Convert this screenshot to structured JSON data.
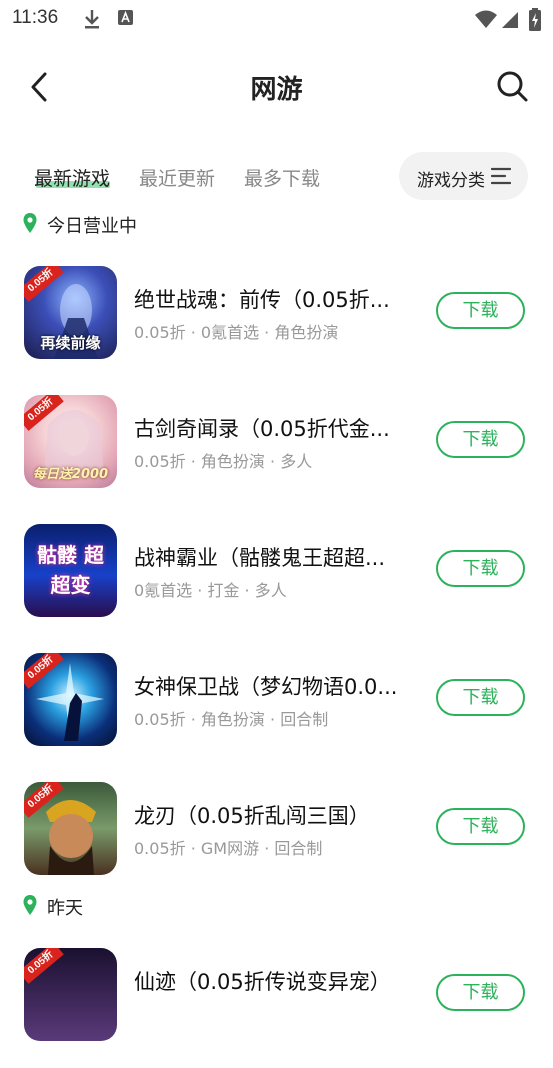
{
  "status_bar": {
    "time": "11:36",
    "icons": [
      "download-icon",
      "a-icon",
      "wifi-icon",
      "signal-icon",
      "battery-icon"
    ]
  },
  "header": {
    "title": "网游",
    "back_icon": "chevron-left-icon",
    "search_icon": "search-icon"
  },
  "tabs": {
    "items": [
      {
        "label": "最新游戏",
        "active": true
      },
      {
        "label": "最近更新",
        "active": false
      },
      {
        "label": "最多下载",
        "active": false
      }
    ],
    "category_button": {
      "label": "游戏分类",
      "icon": "filter-lines-icon"
    }
  },
  "colors": {
    "accent": "#2cb25a",
    "badge": "#d8241c",
    "tag_text": "#999999"
  },
  "sections": [
    {
      "label": "今日营业中",
      "games": [
        {
          "name": "绝世战魂：前传（0.05折...",
          "tags": [
            "0.05折",
            "0氪首选",
            "角色扮演"
          ],
          "badge": "0.05折",
          "thumb_text": "再续前缘",
          "button": "下载"
        },
        {
          "name": "古剑奇闻录（0.05折代金...",
          "tags": [
            "0.05折",
            "角色扮演",
            "多人"
          ],
          "badge": "0.05折",
          "thumb_text": "每日送2000",
          "button": "下载"
        },
        {
          "name": "战神霸业（骷髅鬼王超超...",
          "tags": [
            "0氪首选",
            "打金",
            "多人"
          ],
          "badge": "",
          "thumb_text": "骷髅 超超变",
          "button": "下载"
        },
        {
          "name": "女神保卫战（梦幻物语0.0...",
          "tags": [
            "0.05折",
            "角色扮演",
            "回合制"
          ],
          "badge": "0.05折",
          "thumb_text": "",
          "button": "下载"
        },
        {
          "name": "龙刃（0.05折乱闯三国）",
          "tags": [
            "0.05折",
            "GM网游",
            "回合制"
          ],
          "badge": "0.05折",
          "thumb_text": "",
          "button": "下载"
        }
      ]
    },
    {
      "label": "昨天",
      "games": [
        {
          "name": "仙迹（0.05折传说变异宠）",
          "tags": [],
          "badge": "0.05折",
          "thumb_text": "",
          "button": "下载"
        }
      ]
    }
  ]
}
